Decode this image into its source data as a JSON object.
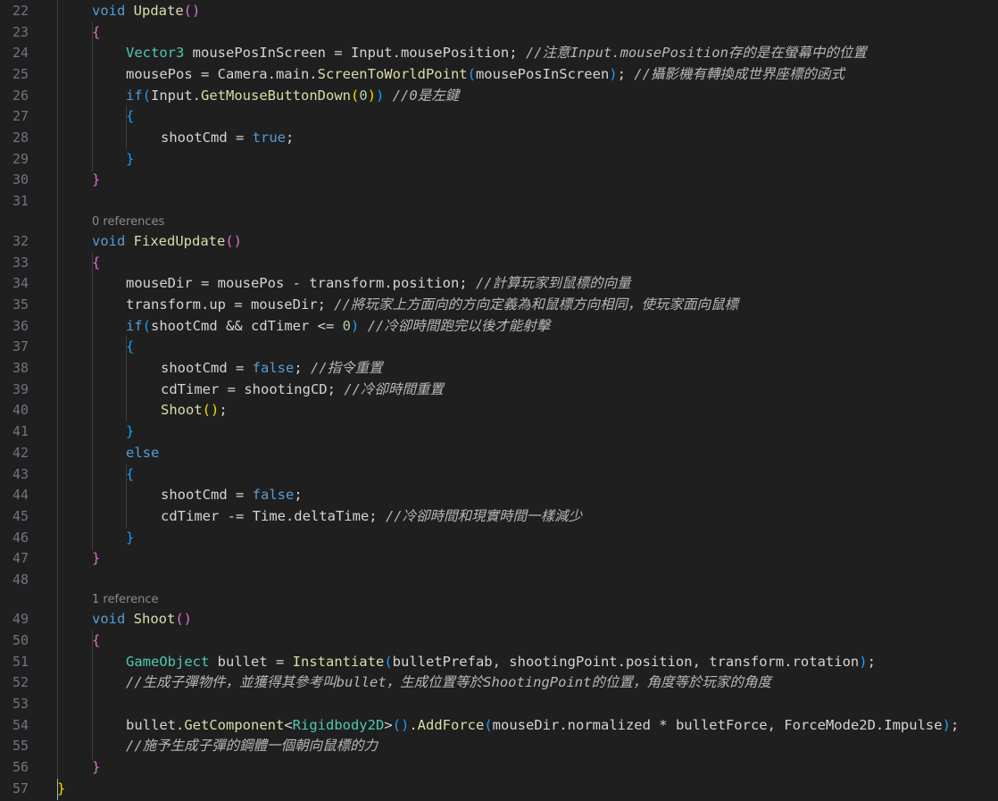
{
  "editor": {
    "code_lens": {
      "fixed_update": "0 references",
      "shoot": "1 reference"
    },
    "lines": [
      {
        "n": "22",
        "segs": [
          [
            "kw",
            "void"
          ],
          [
            "id",
            " "
          ],
          [
            "fn",
            "Update"
          ],
          [
            "b2",
            "()"
          ]
        ]
      },
      {
        "n": "23",
        "segs": [
          [
            "b2",
            "{"
          ]
        ]
      },
      {
        "n": "24",
        "segs": [
          [
            "ty",
            "Vector3"
          ],
          [
            "id",
            " mousePosInScreen = Input.mousePosition; "
          ],
          [
            "cm",
            "//注意Input.mousePosition存的是在螢幕中的位置"
          ]
        ]
      },
      {
        "n": "25",
        "segs": [
          [
            "id",
            "mousePos = Camera.main."
          ],
          [
            "fn",
            "ScreenToWorldPoint"
          ],
          [
            "b3",
            "("
          ],
          [
            "id",
            "mousePosInScreen"
          ],
          [
            "b3",
            ")"
          ],
          [
            "id",
            "; "
          ],
          [
            "cm",
            "//攝影機有轉換成世界座標的函式"
          ]
        ]
      },
      {
        "n": "26",
        "segs": [
          [
            "kw",
            "if"
          ],
          [
            "b3",
            "("
          ],
          [
            "id",
            "Input."
          ],
          [
            "fn",
            "GetMouseButtonDown"
          ],
          [
            "b1",
            "("
          ],
          [
            "num",
            "0"
          ],
          [
            "b1",
            ")"
          ],
          [
            "b3",
            ")"
          ],
          [
            "id",
            " "
          ],
          [
            "cm",
            "//0是左鍵"
          ]
        ]
      },
      {
        "n": "27",
        "segs": [
          [
            "b3",
            "{"
          ]
        ]
      },
      {
        "n": "28",
        "segs": [
          [
            "id",
            "shootCmd = "
          ],
          [
            "kw",
            "true"
          ],
          [
            "id",
            ";"
          ]
        ]
      },
      {
        "n": "29",
        "segs": [
          [
            "b3",
            "}"
          ]
        ]
      },
      {
        "n": "30",
        "segs": [
          [
            "b2",
            "}"
          ]
        ]
      },
      {
        "n": "31",
        "segs": []
      },
      {
        "n": "32",
        "segs": [
          [
            "kw",
            "void"
          ],
          [
            "id",
            " "
          ],
          [
            "fn",
            "FixedUpdate"
          ],
          [
            "b2",
            "()"
          ]
        ]
      },
      {
        "n": "33",
        "segs": [
          [
            "b2",
            "{"
          ]
        ]
      },
      {
        "n": "34",
        "segs": [
          [
            "id",
            "mouseDir = mousePos - transform.position; "
          ],
          [
            "cm",
            "//計算玩家到鼠標的向量"
          ]
        ]
      },
      {
        "n": "35",
        "segs": [
          [
            "id",
            "transform.up = mouseDir; "
          ],
          [
            "cm",
            "//將玩家上方面向的方向定義為和鼠標方向相同，使玩家面向鼠標"
          ]
        ]
      },
      {
        "n": "36",
        "segs": [
          [
            "kw",
            "if"
          ],
          [
            "b3",
            "("
          ],
          [
            "id",
            "shootCmd && cdTimer <= "
          ],
          [
            "num",
            "0"
          ],
          [
            "b3",
            ")"
          ],
          [
            "id",
            " "
          ],
          [
            "cm",
            "//冷卻時間跑完以後才能射擊"
          ]
        ]
      },
      {
        "n": "37",
        "segs": [
          [
            "b3",
            "{"
          ]
        ]
      },
      {
        "n": "38",
        "segs": [
          [
            "id",
            "shootCmd = "
          ],
          [
            "kw",
            "false"
          ],
          [
            "id",
            "; "
          ],
          [
            "cm",
            "//指令重置"
          ]
        ]
      },
      {
        "n": "39",
        "segs": [
          [
            "id",
            "cdTimer = shootingCD; "
          ],
          [
            "cm",
            "//冷卻時間重置"
          ]
        ]
      },
      {
        "n": "40",
        "segs": [
          [
            "fn",
            "Shoot"
          ],
          [
            "b1",
            "()"
          ],
          [
            "id",
            ";"
          ]
        ]
      },
      {
        "n": "41",
        "segs": [
          [
            "b3",
            "}"
          ]
        ]
      },
      {
        "n": "42",
        "segs": [
          [
            "kw",
            "else"
          ]
        ]
      },
      {
        "n": "43",
        "segs": [
          [
            "b3",
            "{"
          ]
        ]
      },
      {
        "n": "44",
        "segs": [
          [
            "id",
            "shootCmd = "
          ],
          [
            "kw",
            "false"
          ],
          [
            "id",
            ";"
          ]
        ]
      },
      {
        "n": "45",
        "segs": [
          [
            "id",
            "cdTimer -= Time.deltaTime; "
          ],
          [
            "cm",
            "//冷卻時間和現實時間一樣減少"
          ]
        ]
      },
      {
        "n": "46",
        "segs": [
          [
            "b3",
            "}"
          ]
        ]
      },
      {
        "n": "47",
        "segs": [
          [
            "b2",
            "}"
          ]
        ]
      },
      {
        "n": "48",
        "segs": []
      },
      {
        "n": "49",
        "segs": [
          [
            "kw",
            "void"
          ],
          [
            "id",
            " "
          ],
          [
            "fn",
            "Shoot"
          ],
          [
            "b2",
            "()"
          ]
        ]
      },
      {
        "n": "50",
        "segs": [
          [
            "b2",
            "{"
          ]
        ]
      },
      {
        "n": "51",
        "segs": [
          [
            "ty",
            "GameObject"
          ],
          [
            "id",
            " bullet = "
          ],
          [
            "fn",
            "Instantiate"
          ],
          [
            "b3",
            "("
          ],
          [
            "id",
            "bulletPrefab, shootingPoint.position, transform.rotation"
          ],
          [
            "b3",
            ")"
          ],
          [
            "id",
            ";"
          ]
        ]
      },
      {
        "n": "52",
        "segs": [
          [
            "cm",
            "//生成子彈物件，並獲得其參考叫bullet，生成位置等於ShootingPoint的位置，角度等於玩家的角度"
          ]
        ]
      },
      {
        "n": "53",
        "segs": []
      },
      {
        "n": "54",
        "segs": [
          [
            "id",
            "bullet."
          ],
          [
            "fn",
            "GetComponent"
          ],
          [
            "id",
            "<"
          ],
          [
            "ty",
            "Rigidbody2D"
          ],
          [
            "id",
            ">"
          ],
          [
            "b3",
            "()"
          ],
          [
            "id",
            "."
          ],
          [
            "fn",
            "AddForce"
          ],
          [
            "b3",
            "("
          ],
          [
            "id",
            "mouseDir.normalized * bulletForce, ForceMode2D.Impulse"
          ],
          [
            "b3",
            ")"
          ],
          [
            "id",
            ";"
          ]
        ]
      },
      {
        "n": "55",
        "segs": [
          [
            "cm",
            "//施予生成子彈的鋼體一個朝向鼠標的力"
          ]
        ]
      },
      {
        "n": "56",
        "segs": [
          [
            "b2",
            "}"
          ]
        ]
      },
      {
        "n": "57",
        "segs": [
          [
            "b1",
            "}"
          ]
        ]
      }
    ]
  }
}
